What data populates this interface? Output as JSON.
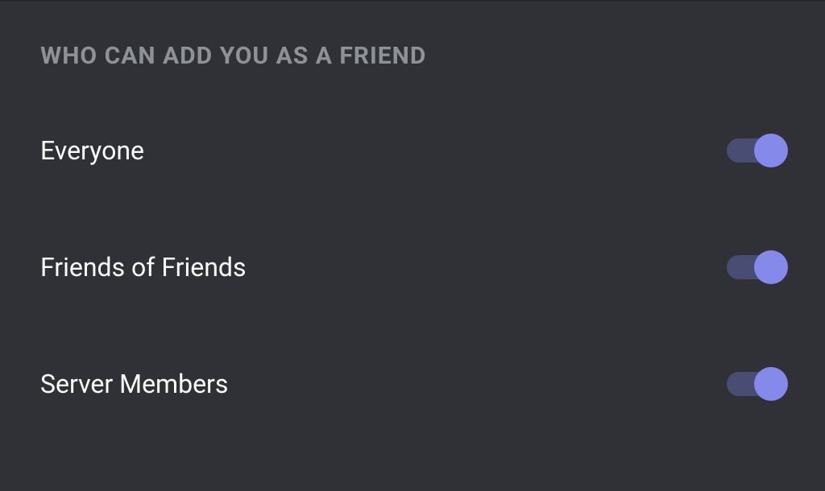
{
  "section": {
    "heading": "WHO CAN ADD YOU AS A FRIEND",
    "options": [
      {
        "label": "Everyone",
        "enabled": true
      },
      {
        "label": "Friends of Friends",
        "enabled": true
      },
      {
        "label": "Server Members",
        "enabled": true
      }
    ]
  },
  "colors": {
    "background": "#2f3136",
    "heading": "#8e9297",
    "label": "#ffffff",
    "toggleTrack": "#4a4d72",
    "toggleThumb": "#8589ea"
  }
}
